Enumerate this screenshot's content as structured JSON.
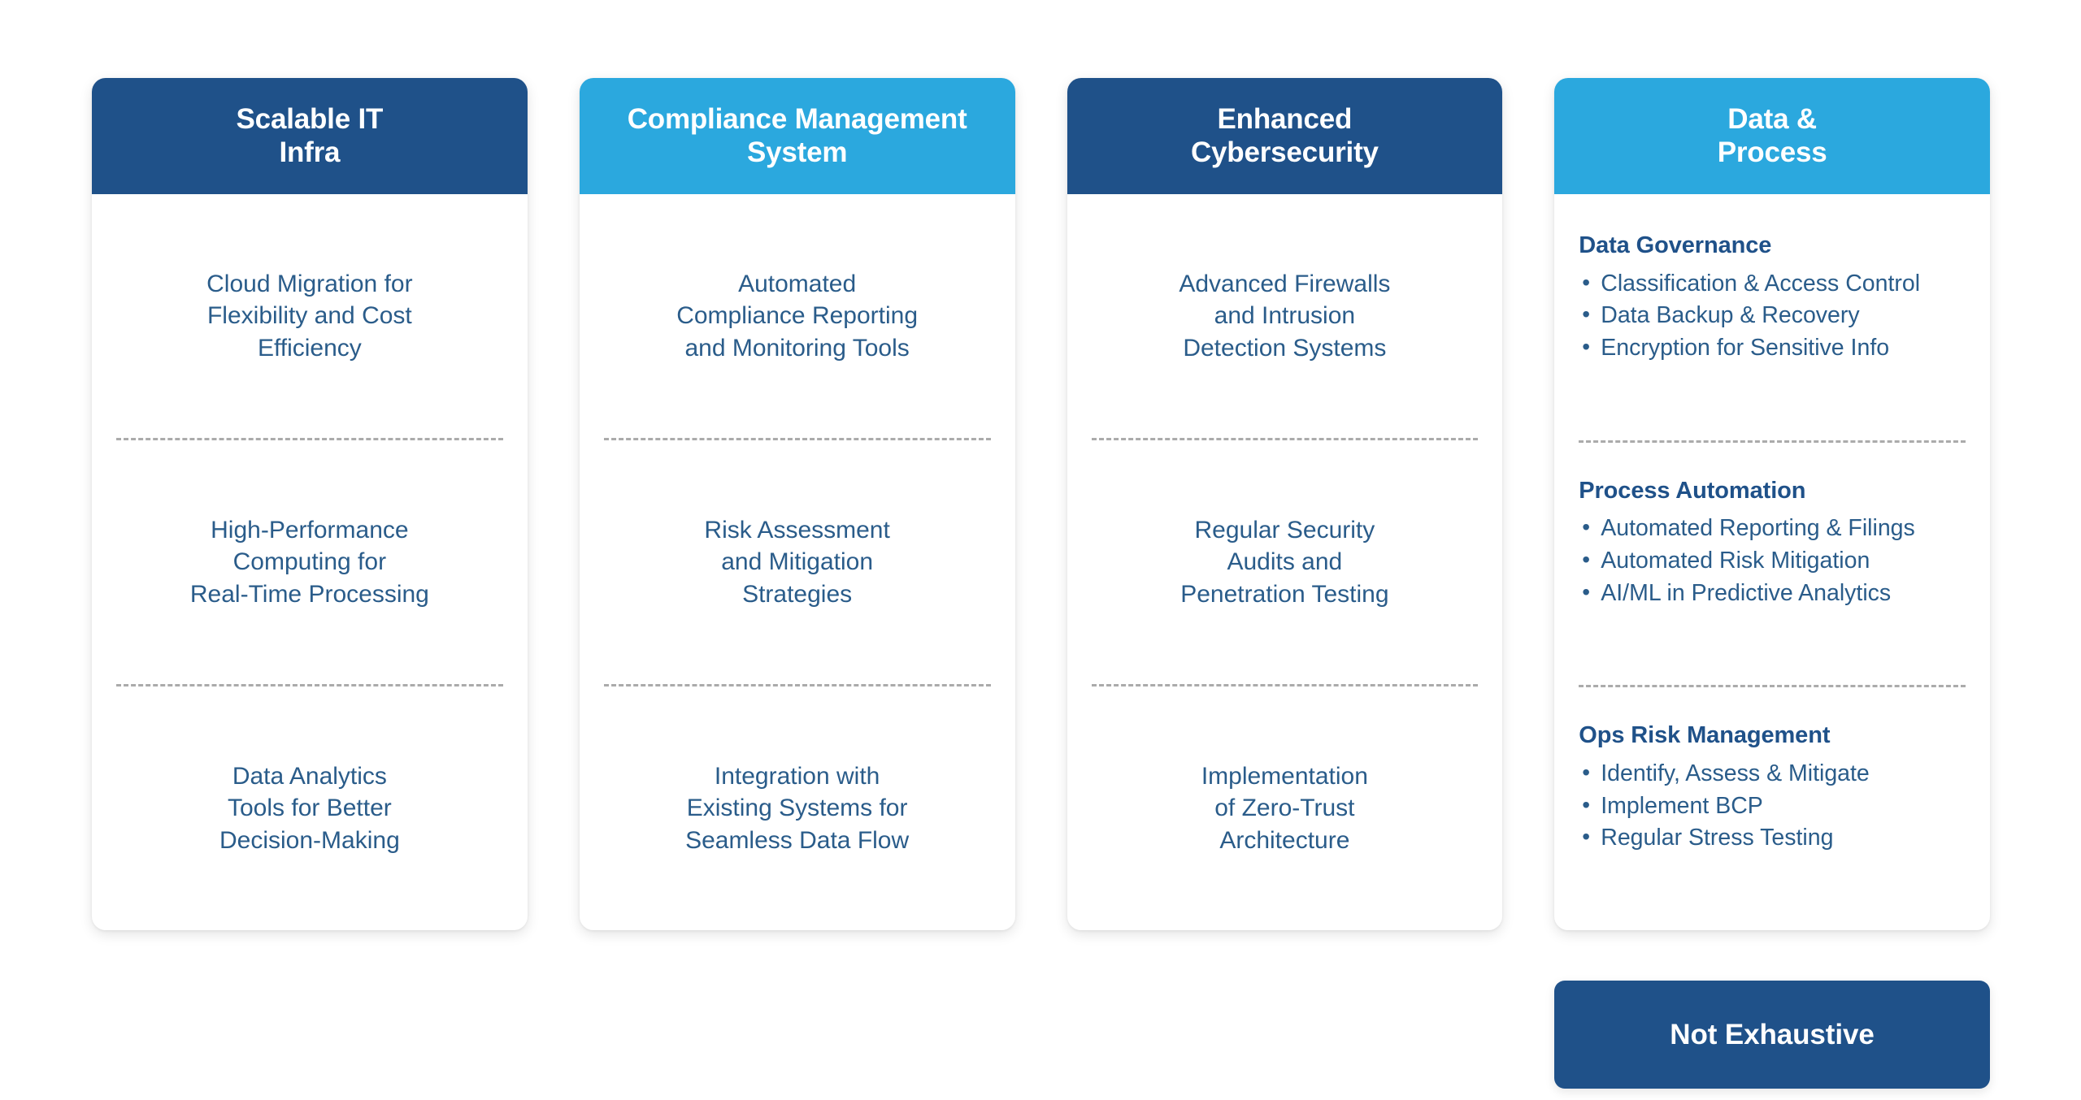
{
  "colors": {
    "header_dark": "#1F5189",
    "header_light": "#2BA8DE",
    "body_text": "#2A5C8A",
    "heading_text": "#1F5189",
    "divider": "#9D9D9D",
    "card_background": "#FFFFFF",
    "page_background": "#FFFFFF"
  },
  "cards": [
    {
      "title_line1": "Scalable IT",
      "title_line2": "Infra",
      "header_style": "dark",
      "layout": "centered",
      "segments": [
        {
          "lines": [
            "Cloud Migration for",
            "Flexibility and Cost",
            "Efficiency"
          ]
        },
        {
          "lines": [
            "High-Performance",
            "Computing for",
            "Real-Time Processing"
          ]
        },
        {
          "lines": [
            "Data Analytics",
            "Tools for Better",
            "Decision-Making"
          ]
        }
      ]
    },
    {
      "title_line1": "Compliance Management",
      "title_line2": "System",
      "header_style": "light",
      "layout": "centered",
      "segments": [
        {
          "lines": [
            "Automated",
            "Compliance Reporting",
            "and Monitoring Tools"
          ]
        },
        {
          "lines": [
            "Risk Assessment",
            "and Mitigation",
            "Strategies"
          ]
        },
        {
          "lines": [
            "Integration with",
            "Existing Systems for",
            "Seamless Data Flow"
          ]
        }
      ]
    },
    {
      "title_line1": "Enhanced",
      "title_line2": "Cybersecurity",
      "header_style": "dark",
      "layout": "centered",
      "segments": [
        {
          "lines": [
            "Advanced Firewalls",
            "and Intrusion",
            "Detection Systems"
          ]
        },
        {
          "lines": [
            "Regular Security",
            "Audits and",
            "Penetration Testing"
          ]
        },
        {
          "lines": [
            "Implementation",
            "of Zero-Trust",
            "Architecture"
          ]
        }
      ]
    },
    {
      "title_line1": "Data &",
      "title_line2": "Process",
      "header_style": "light",
      "layout": "bulleted",
      "sections": [
        {
          "heading": "Data Governance",
          "bullets": [
            "Classification & Access Control",
            "Data Backup & Recovery",
            "Encryption for Sensitive Info"
          ]
        },
        {
          "heading": "Process Automation",
          "bullets": [
            "Automated Reporting & Filings",
            "Automated Risk Mitigation",
            "AI/ML in Predictive Analytics"
          ]
        },
        {
          "heading": "Ops Risk Management",
          "bullets": [
            "Identify, Assess & Mitigate",
            "Implement BCP",
            "Regular Stress Testing"
          ]
        }
      ]
    }
  ],
  "footer": {
    "not_exhaustive_label": "Not Exhaustive"
  }
}
